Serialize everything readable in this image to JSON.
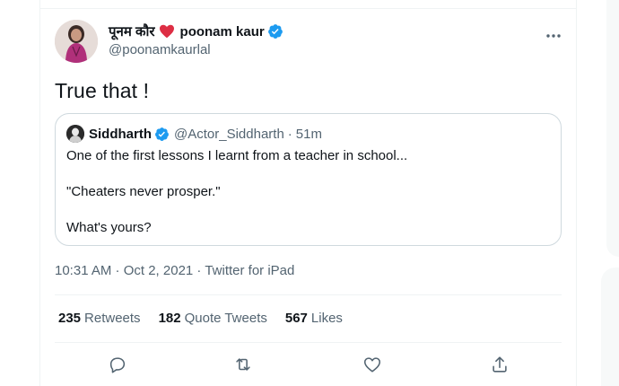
{
  "tweet": {
    "author_name_hindi": "पूनम कौर",
    "author_name_en": "poonam kaur",
    "handle": "@poonamkaurlal",
    "text": "True that !",
    "timestamp": "10:31 AM · Oct 2, 2021 · Twitter for iPad",
    "verified_color": "#1d9bf0",
    "heart_color": "#dd2e44"
  },
  "quote": {
    "name": "Siddharth",
    "handle": "@Actor_Siddharth",
    "dot": "·",
    "time": "51m",
    "lines": [
      "One of the first lessons I learnt from a teacher in school...",
      "\"Cheaters never prosper.\"",
      "What's yours?"
    ]
  },
  "stats": {
    "retweets_count": "235",
    "retweets_label": "Retweets",
    "quotes_count": "182",
    "quotes_label": "Quote Tweets",
    "likes_count": "567",
    "likes_label": "Likes"
  },
  "actions": [
    "reply-icon",
    "retweet-icon",
    "like-icon",
    "share-icon"
  ],
  "more_icon": "more-icon"
}
